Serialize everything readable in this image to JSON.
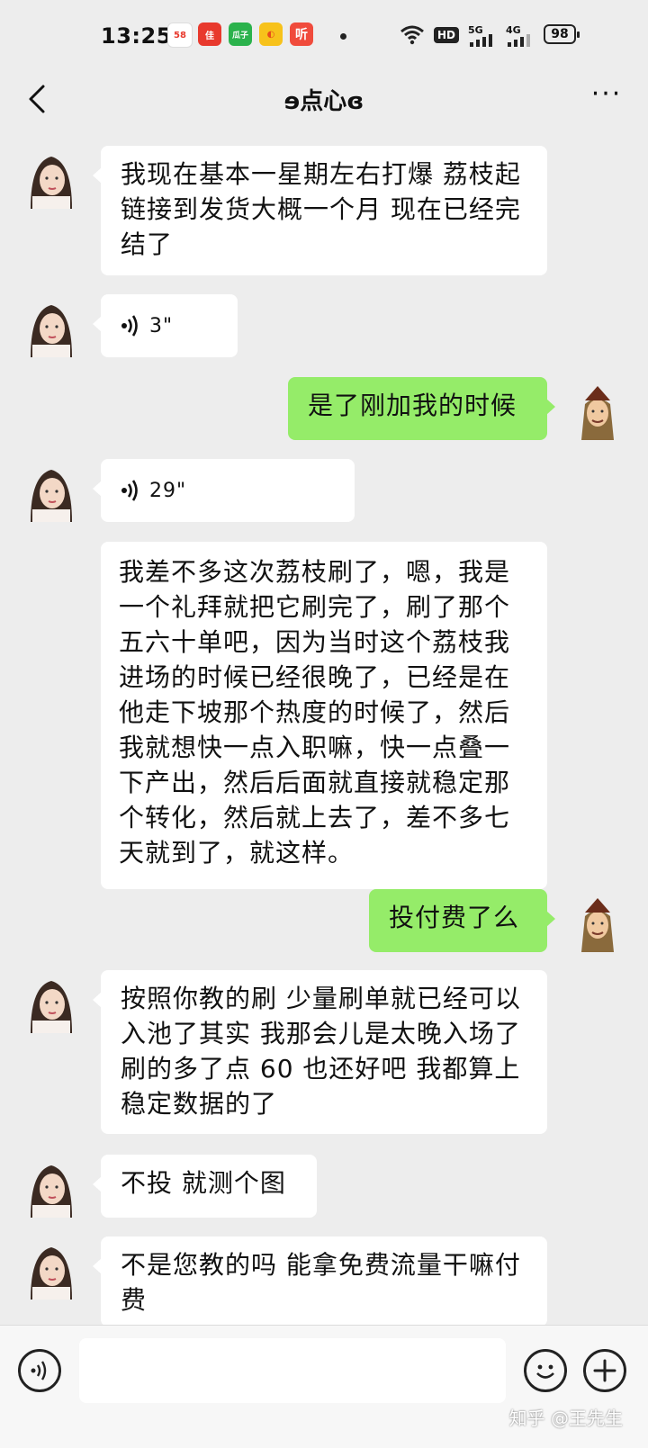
{
  "status_bar": {
    "time": "13:25",
    "app_icons": [
      {
        "label": "58",
        "color": "#ffffff",
        "text_color": "#e8392d"
      },
      {
        "label": "佳",
        "color": "#e8392d",
        "text_color": "#ffffff"
      },
      {
        "label": "瓜子",
        "color": "#2bb24c",
        "text_color": "#ffffff"
      },
      {
        "label": "◐",
        "color": "#f7c21b",
        "text_color": "#e84b1b"
      },
      {
        "label": "听",
        "color": "#f04b3c",
        "text_color": "#ffffff"
      }
    ],
    "network": [
      "HD",
      "5G",
      "4G"
    ],
    "battery": "98"
  },
  "header": {
    "title": "ɘ点心ɞ"
  },
  "messages": [
    {
      "side": "left",
      "type": "text",
      "text": "我现在基本一星期左右打爆 荔枝起链接到发货大概一个月 现在已经完结了"
    },
    {
      "side": "left",
      "type": "voice",
      "duration": "3\""
    },
    {
      "side": "right",
      "type": "text",
      "text": "是了刚加我的时候"
    },
    {
      "side": "left",
      "type": "voice",
      "duration": "29\""
    },
    {
      "side": "left",
      "type": "text",
      "text": "我差不多这次荔枝刷了，嗯，我是一个礼拜就把它刷完了，刷了那个五六十单吧，因为当时这个荔枝我进场的时候已经很晚了，已经是在他走下坡那个热度的时候了，然后我就想快一点入职嘛，快一点叠一下产出，然后后面就直接就稳定那个转化，然后就上去了，差不多七天就到了，就这样。"
    },
    {
      "side": "right",
      "type": "text",
      "text": "投付费了么"
    },
    {
      "side": "left",
      "type": "text",
      "text": "按照你教的刷 少量刷单就已经可以入池了其实  我那会儿是太晚入场了 刷的多了点 60 也还好吧 我都算上稳定数据的了"
    },
    {
      "side": "left",
      "type": "text",
      "text": "不投 就测个图"
    },
    {
      "side": "left",
      "type": "text",
      "text": "不是您教的吗  能拿免费流量干嘛付费"
    }
  ],
  "input_bar": {
    "voice_icon": "voice-input-icon",
    "emoji_icon": "emoji-icon",
    "plus_icon": "plus-icon",
    "input_value": ""
  },
  "watermark": "知乎 @王先生",
  "colors": {
    "background": "#ededed",
    "bubble_other": "#ffffff",
    "bubble_me": "#95ec69"
  }
}
